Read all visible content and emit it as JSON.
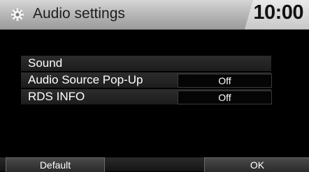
{
  "header": {
    "title": "Audio settings",
    "clock": "10:00",
    "icon": "gear-icon"
  },
  "menu": {
    "items": [
      {
        "label": "Sound",
        "value": null
      },
      {
        "label": "Audio Source Pop-Up",
        "value": "Off"
      },
      {
        "label": "RDS INFO",
        "value": "Off"
      }
    ]
  },
  "footer": {
    "default_label": "Default",
    "ok_label": "OK"
  },
  "colors": {
    "header_bg": "#b9b9b9",
    "clock_bg": "#d9d9d9",
    "screen_bg": "#000000",
    "row_bg": "#262626"
  }
}
